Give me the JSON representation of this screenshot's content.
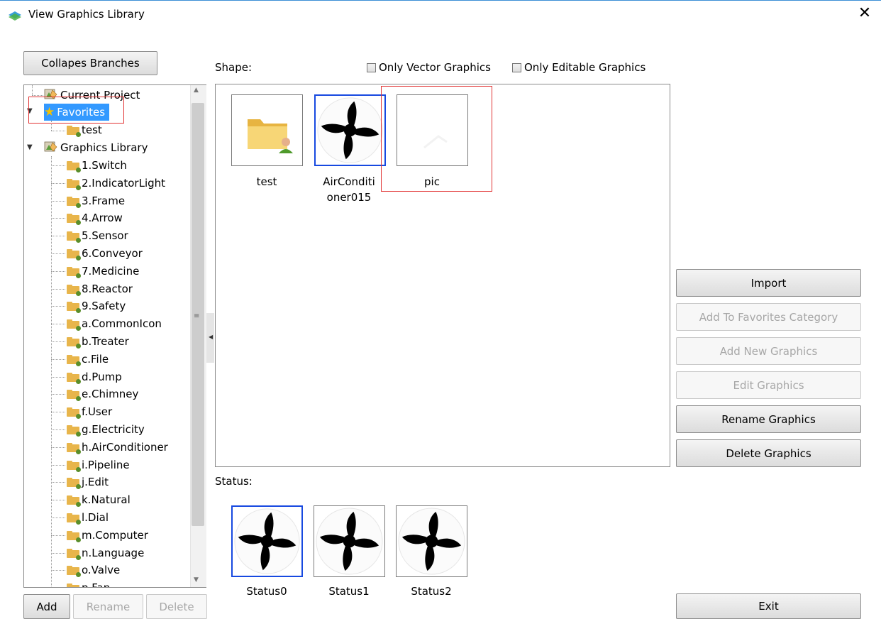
{
  "window": {
    "title": "View Graphics Library",
    "close_glyph": "✕"
  },
  "toolbar": {
    "collapse_label": "Collapes Branches"
  },
  "tree": {
    "current_project": "Current Project",
    "favorites": "Favorites",
    "favorites_children": [
      "test"
    ],
    "graphics_library": "Graphics Library",
    "library_children": [
      "1.Switch",
      "2.IndicatorLight",
      "3.Frame",
      "4.Arrow",
      "5.Sensor",
      "6.Conveyor",
      "7.Medicine",
      "8.Reactor",
      "9.Safety",
      "a.CommonIcon",
      "b.Treater",
      "c.File",
      "d.Pump",
      "e.Chimney",
      "f.User",
      "g.Electricity",
      "h.AirConditioner",
      "i.Pipeline",
      "j.Edit",
      "k.Natural",
      "l.Dial",
      "m.Computer",
      "n.Language",
      "o.Valve",
      "p.Fan"
    ]
  },
  "tree_buttons": {
    "add": "Add",
    "rename": "Rename",
    "delete": "Delete"
  },
  "shape": {
    "label": "Shape:",
    "only_vector": "Only Vector Graphics",
    "only_editable": "Only Editable Graphics",
    "items": [
      {
        "caption": "test",
        "icon": "folder-user-icon"
      },
      {
        "caption": "AirConditi oner015",
        "icon": "fan-icon",
        "selected": true
      },
      {
        "caption": "pic",
        "icon": "blank-image-icon"
      }
    ]
  },
  "status": {
    "label": "Status:",
    "items": [
      {
        "caption": "Status0",
        "icon": "fan-icon",
        "selected": true
      },
      {
        "caption": "Status1",
        "icon": "fan-icon"
      },
      {
        "caption": "Status2",
        "icon": "fan-icon"
      }
    ]
  },
  "actions": {
    "import": "Import",
    "add_to_favorites": "Add To Favorites Category",
    "add_new": "Add New Graphics",
    "edit": "Edit Graphics",
    "rename": "Rename Graphics",
    "delete": "Delete Graphics",
    "exit": "Exit"
  },
  "colors": {
    "selection_blue": "#1749e0",
    "highlight_red": "#e23434",
    "favorites_highlight": "#3399ff"
  }
}
